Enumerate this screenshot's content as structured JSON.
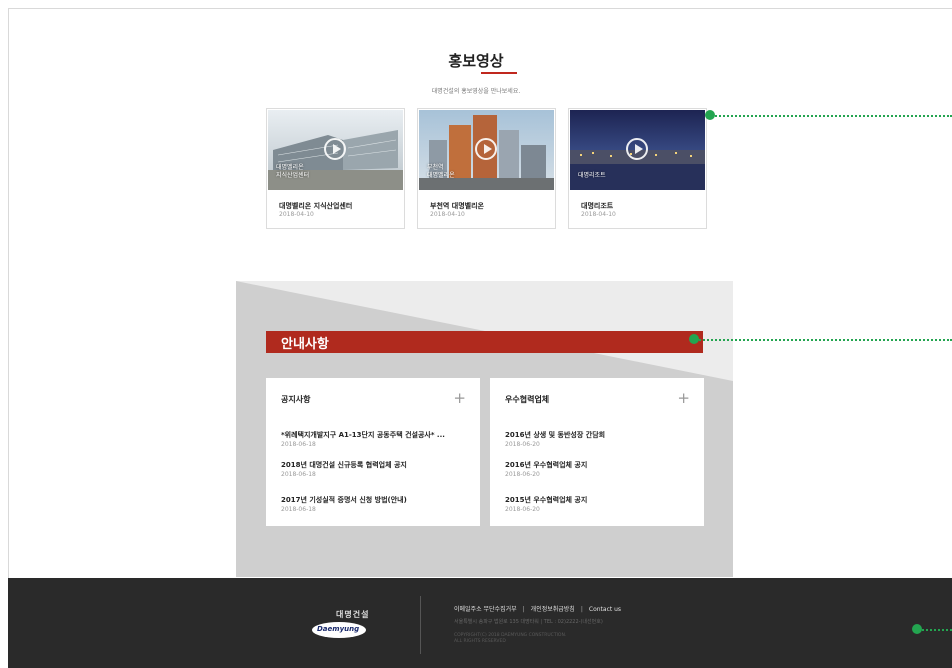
{
  "promo": {
    "title": "홍보영상",
    "subtitle": "대명건설의 홍보영상을 만나보세요.",
    "videos": [
      {
        "caption": "대명벨리온\n지식산업센터",
        "title": "대명벨리온 지식산업센터",
        "date": "2018-04-10"
      },
      {
        "caption": "부천역\n대명벨리온",
        "title": "부천역 대명벨리온",
        "date": "2018-04-10"
      },
      {
        "caption": "대명리조트",
        "title": "대명리조트",
        "date": "2018-04-10"
      }
    ]
  },
  "notice": {
    "title": "안내사항",
    "panels": [
      {
        "heading": "공지사항",
        "plus": "+",
        "items": [
          {
            "title": "*위례택지개발지구 A1-13단지 공동주택 건설공사* ...",
            "date": "2018-06-18"
          },
          {
            "title": "2018년 대명건설 신규등록 협력업체 공지",
            "date": "2018-06-18"
          },
          {
            "title": "2017년 기성실적 증명서 신청 방법(안내)",
            "date": "2018-06-18"
          }
        ]
      },
      {
        "heading": "우수협력업체",
        "plus": "+",
        "items": [
          {
            "title": "2016년 상생 및 동반성장 간담회",
            "date": "2018-06-20"
          },
          {
            "title": "2016년 우수협력업체 공지",
            "date": "2018-06-20"
          },
          {
            "title": "2015년 우수협력업체 공지",
            "date": "2018-06-20"
          }
        ]
      }
    ]
  },
  "footer": {
    "brand_kr": "대명건설",
    "brand_logo": "Daemyung",
    "links": [
      "이메일주소 무단수집거부",
      "개인정보취급방침",
      "Contact us"
    ],
    "link_sep": "|",
    "address": "서울특별시 송파구 법원로 135 대명타워 | TEL : 02)2222-(내선번호)",
    "copyright": "COPYRIGHT(C) 2018 DAEMYUNG CONSTRUCTION.\nALL RIGHTS RESERVED"
  },
  "colors": {
    "accent_red": "#b02a1e",
    "marker_green": "#23a550",
    "footer_bg": "#2a2a2a"
  }
}
